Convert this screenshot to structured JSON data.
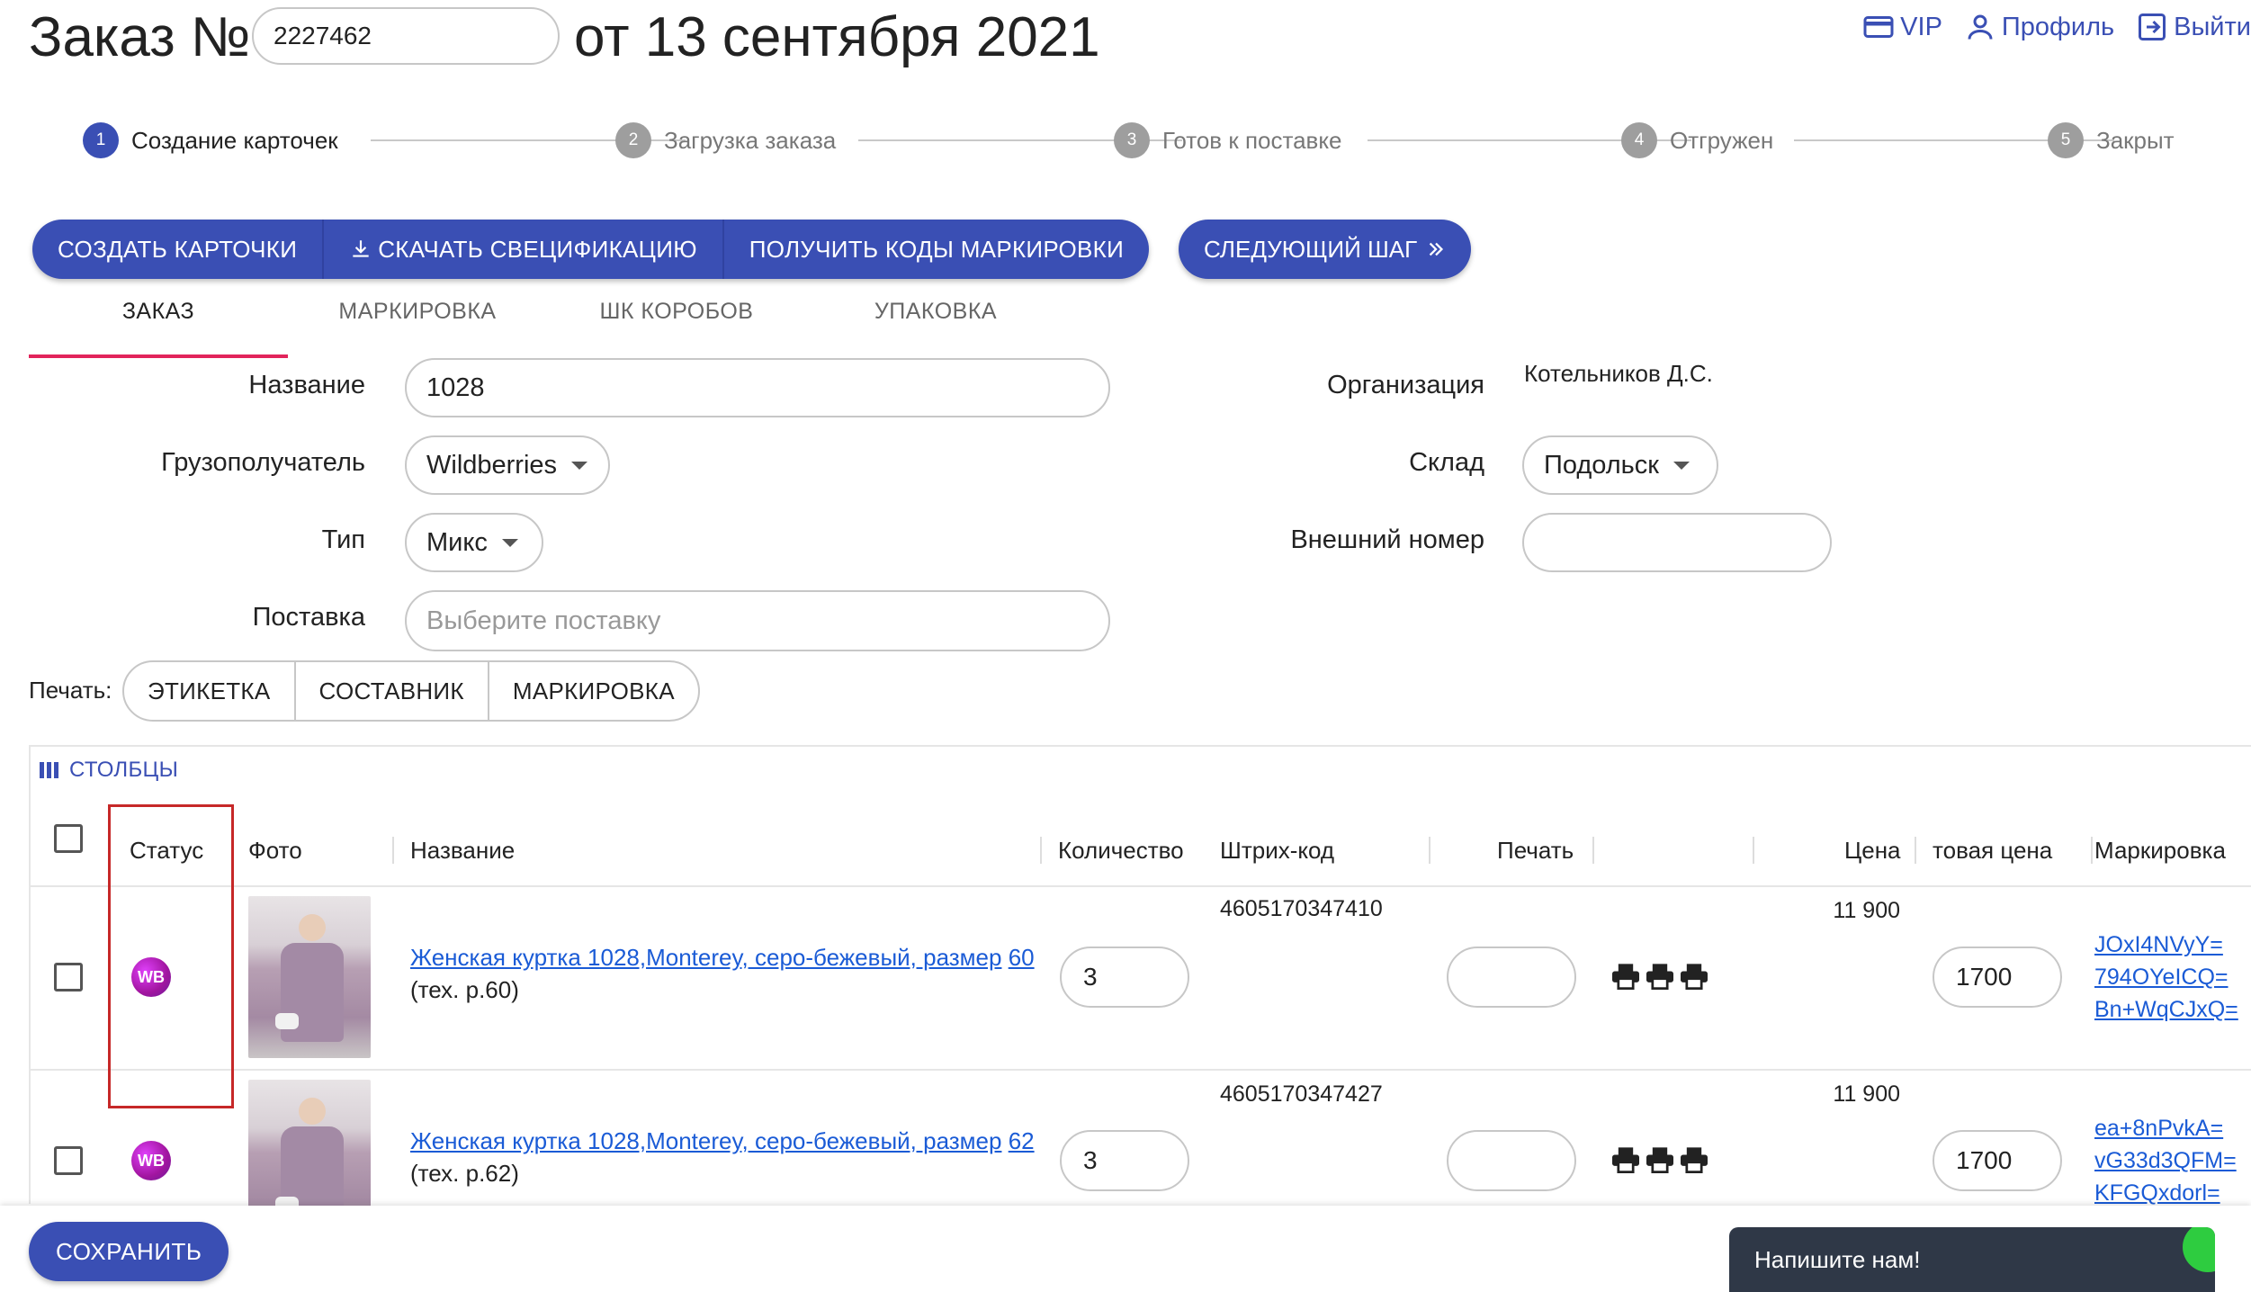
{
  "header": {
    "title": "Заказ №",
    "order_number": "2227462",
    "date_text": "от 13 сентября 2021",
    "links": [
      {
        "label": "VIP",
        "icon": "card-icon"
      },
      {
        "label": "Профиль",
        "icon": "user-icon"
      },
      {
        "label": "Выйти",
        "icon": "logout-icon"
      }
    ]
  },
  "stepper": {
    "steps": [
      {
        "num": "1",
        "label": "Создание карточек",
        "active": true
      },
      {
        "num": "2",
        "label": "Загрузка заказа",
        "active": false
      },
      {
        "num": "3",
        "label": "Готов к поставке",
        "active": false
      },
      {
        "num": "4",
        "label": "Отгружен",
        "active": false
      },
      {
        "num": "5",
        "label": "Закрыт",
        "active": false
      }
    ]
  },
  "actions": {
    "create_cards": "СОЗДАТЬ КАРТОЧКИ",
    "download_spec": "СКАЧАТЬ СВЕЦИФИКАЦИЮ",
    "get_codes": "ПОЛУЧИТЬ КОДЫ МАРКИРОВКИ",
    "next_step": "СЛЕДУЮЩИЙ ШАГ"
  },
  "tabs": [
    "ЗАКАЗ",
    "МАРКИРОВКА",
    "ШК КОРОБОВ",
    "УПАКОВКА"
  ],
  "form": {
    "name_label": "Название",
    "name_value": "1028",
    "consignee_label": "Грузополучатель",
    "consignee_value": "Wildberries",
    "type_label": "Тип",
    "type_value": "Микс",
    "supply_label": "Поставка",
    "supply_placeholder": "Выберите поставку",
    "org_label": "Организация",
    "org_value": "Котельников Д.С.",
    "warehouse_label": "Склад",
    "warehouse_value": "Подольск",
    "external_label": "Внешний номер",
    "external_value": ""
  },
  "print": {
    "label": "Печать:",
    "buttons": [
      "ЭТИКЕТКА",
      "СОСТАВНИК",
      "МАРКИРОВКА"
    ]
  },
  "table": {
    "columns_button": "СТОЛБЦЫ",
    "headers": {
      "status": "Статус",
      "photo": "Фото",
      "name": "Название",
      "qty": "Количество",
      "barcode": "Штрих-код",
      "print": "Печать",
      "price": "Цена",
      "final_price": "товая цена",
      "marking": "Маркировка"
    },
    "rows": [
      {
        "status": "WB",
        "name_link": "Женская куртка 1028,Monterey, серо-бежевый, размер",
        "name_link2": "60",
        "name_suffix": " (тех. р.60)",
        "qty": "3",
        "barcode": "4605170347410",
        "price": "11 900",
        "final_price": "1700",
        "marking": [
          "JOxI4NVyY=",
          "794OYeICQ=",
          "Bn+WqCJxQ="
        ]
      },
      {
        "status": "WB",
        "name_link": "Женская куртка 1028,Monterey, серо-бежевый, размер",
        "name_link2": "62",
        "name_suffix": " (тех. р.62)",
        "qty": "3",
        "barcode": "4605170347427",
        "price": "11 900",
        "final_price": "1700",
        "marking": [
          "ea+8nPvkA=",
          "vG33d3QFM=",
          "KFGQxdorl="
        ]
      }
    ]
  },
  "footer": {
    "save": "СОХРАНИТЬ",
    "chat": "Напишите нам!"
  },
  "colors": {
    "primary": "#3a4fb4",
    "tab_underline": "#e2245b",
    "link": "#1a5bd6",
    "highlight": "#c62828"
  }
}
